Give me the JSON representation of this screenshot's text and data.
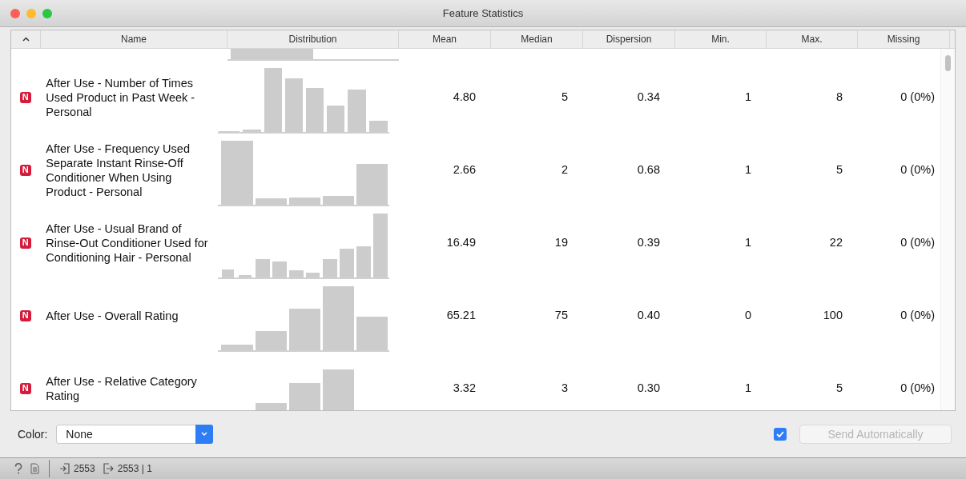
{
  "window": {
    "title": "Feature Statistics"
  },
  "table": {
    "columns": [
      "Name",
      "Distribution",
      "Mean",
      "Median",
      "Dispersion",
      "Min.",
      "Max.",
      "Missing"
    ],
    "rows": [
      {
        "badge": "N",
        "name": "After Use - Number of Times Used Product in Past Week - Personal",
        "mean": "4.80",
        "median": "5",
        "dispersion": "0.34",
        "min": "1",
        "max": "8",
        "missing": "0 (0%)"
      },
      {
        "badge": "N",
        "name": "After Use - Frequency Used Separate Instant Rinse-Off Conditioner When Using Product - Personal",
        "mean": "2.66",
        "median": "2",
        "dispersion": "0.68",
        "min": "1",
        "max": "5",
        "missing": "0 (0%)"
      },
      {
        "badge": "N",
        "name": "After Use - Usual Brand of Rinse-Out Conditioner Used for Conditioning Hair - Personal",
        "mean": "16.49",
        "median": "19",
        "dispersion": "0.39",
        "min": "1",
        "max": "22",
        "missing": "0 (0%)"
      },
      {
        "badge": "N",
        "name": "After Use - Overall Rating",
        "mean": "65.21",
        "median": "75",
        "dispersion": "0.40",
        "min": "0",
        "max": "100",
        "missing": "0 (0%)"
      },
      {
        "badge": "N",
        "name": "After Use - Relative Category Rating",
        "mean": "3.32",
        "median": "3",
        "dispersion": "0.30",
        "min": "1",
        "max": "5",
        "missing": "0 (0%)"
      }
    ]
  },
  "color_field": {
    "label": "Color:",
    "value": "None"
  },
  "send_automatically": {
    "checked": true,
    "label": "Send Automatically"
  },
  "status_bar": {
    "input_count": "2553",
    "output_count": "2553 | 1"
  }
}
